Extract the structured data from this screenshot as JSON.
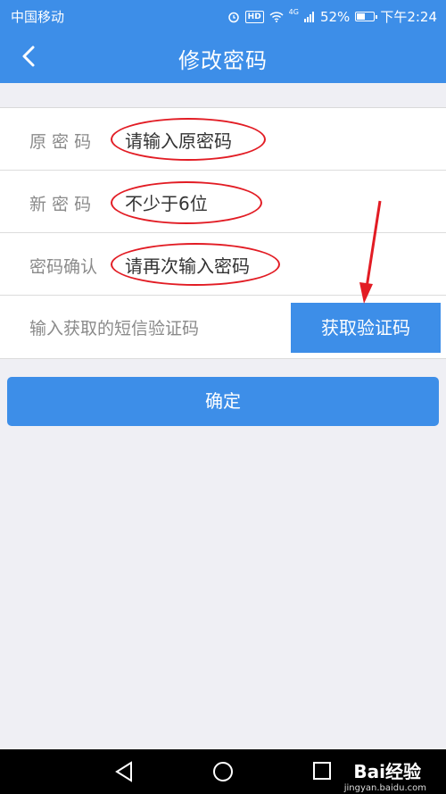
{
  "status_bar": {
    "carrier": "中国移动",
    "hd": "HD",
    "network": "4G",
    "battery": "52%",
    "battery_level": 0.52,
    "time": "下午2:24"
  },
  "nav": {
    "title": "修改密码",
    "back_icon": "chevron-left-icon"
  },
  "form": {
    "old_password": {
      "label": "原 密 码",
      "placeholder": "请输入原密码"
    },
    "new_password": {
      "label": "新 密 码",
      "placeholder": "不少于6位"
    },
    "confirm_password": {
      "label": "密码确认",
      "placeholder": "请再次输入密码"
    },
    "sms_code": {
      "label": "输入获取的短信验证码",
      "button": "获取验证码"
    }
  },
  "confirm_button": "确定",
  "annotations": {
    "color": "#e21c24"
  },
  "system_nav": {
    "back": "triangle-back-icon",
    "home": "circle-home-icon",
    "recent": "square-recent-icon"
  },
  "watermark": {
    "brand": "Bai经验",
    "url": "jingyan.baidu.com"
  },
  "colors": {
    "primary": "#3d8ee8",
    "background": "#efeff4"
  }
}
